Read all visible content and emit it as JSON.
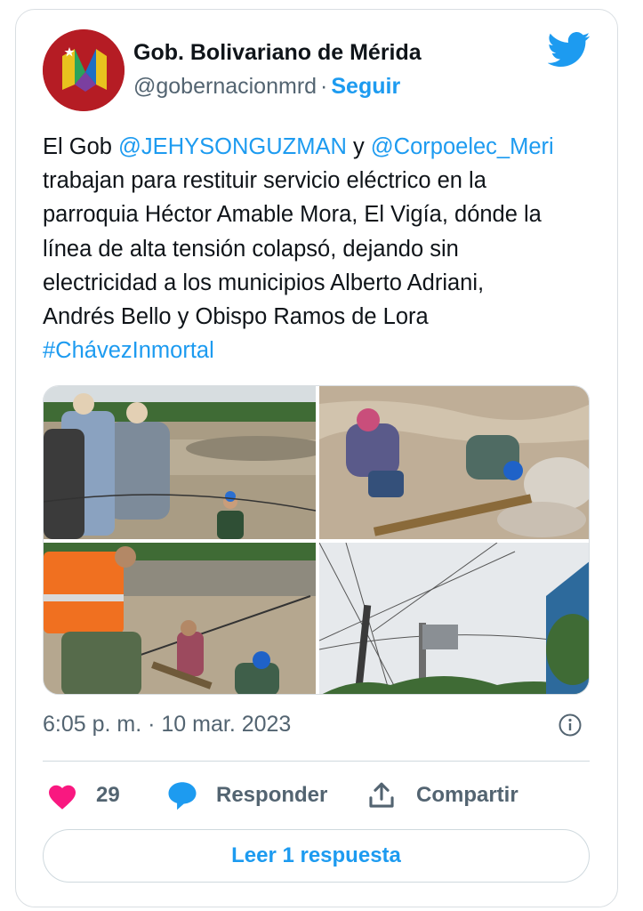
{
  "author": {
    "name": "Gob. Bolivariano de Mérida",
    "handle": "@gobernacionmrd",
    "separator": "·",
    "follow_label": "Seguir"
  },
  "tweet": {
    "lines": [
      [
        {
          "text": "El Gob ",
          "type": "text"
        },
        {
          "text": "@JEHYSONGUZMAN",
          "type": "mention"
        },
        {
          "text": " y ",
          "type": "text"
        },
        {
          "text": "@Corpoelec_Meri",
          "type": "mention"
        }
      ],
      [
        {
          "text": "trabajan para restituir servicio eléctrico en la",
          "type": "text"
        }
      ],
      [
        {
          "text": "parroquia Héctor Amable Mora, El Vigía, dónde la",
          "type": "text"
        }
      ],
      [
        {
          "text": "línea de alta tensión colapsó, dejando sin",
          "type": "text"
        }
      ],
      [
        {
          "text": "electricidad  a los municipios Alberto Adriani,",
          "type": "text"
        }
      ],
      [
        {
          "text": "Andrés Bello y Obispo Ramos de Lora",
          "type": "text"
        }
      ],
      [
        {
          "text": "#ChávezInmortal",
          "type": "hashtag"
        }
      ]
    ]
  },
  "media": {
    "count": 4
  },
  "timestamp": "6:05 p. m. · 10 mar. 2023",
  "actions": {
    "likes_count": "29",
    "reply_label": "Responder",
    "share_label": "Compartir"
  },
  "read_replies_label": "Leer 1 respuesta",
  "colors": {
    "accent": "#1d9bf0",
    "like": "#f91880",
    "secondary_text": "#536471",
    "border": "#cfd9de"
  },
  "icons": [
    "twitter-bird-icon",
    "info-icon",
    "heart-icon",
    "reply-bubble-icon",
    "share-icon"
  ]
}
